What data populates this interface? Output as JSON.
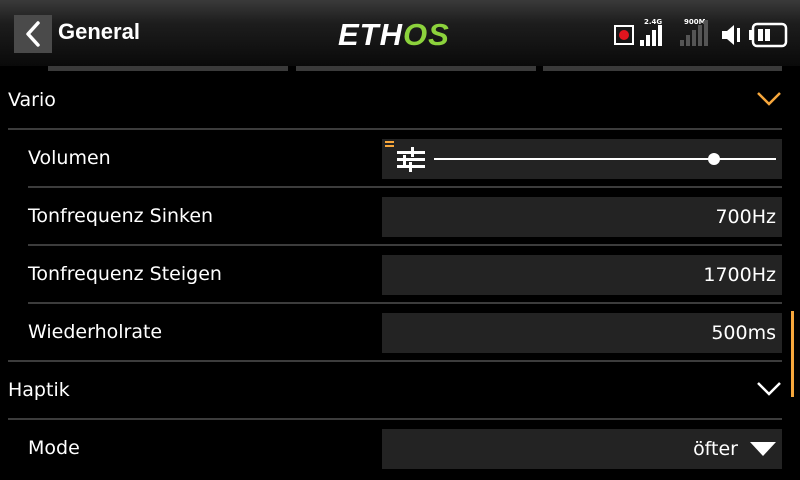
{
  "header": {
    "title": "General",
    "logo_main": "ETH",
    "logo_accent": "OS",
    "signal_2g_label": "2.4G",
    "signal_900m_label": "900M"
  },
  "sections": {
    "vario": {
      "label": "Vario",
      "items": {
        "volumen": {
          "label": "Volumen",
          "slider_level": 0.82
        },
        "tonfrequenz_sinken": {
          "label": "Tonfrequenz Sinken",
          "value": "700Hz"
        },
        "tonfrequenz_steigen": {
          "label": "Tonfrequenz Steigen",
          "value": "1700Hz"
        },
        "wiederholrate": {
          "label": "Wiederholrate",
          "value": "500ms"
        }
      }
    },
    "haptik": {
      "label": "Haptik",
      "items": {
        "mode": {
          "label": "Mode",
          "value": "öfter"
        }
      }
    }
  },
  "colors": {
    "accent": "#f7a73c",
    "logo_green": "#8cd23c",
    "record_red": "#e1141e",
    "field_bg": "#232323",
    "divider": "#3c3c3c"
  }
}
